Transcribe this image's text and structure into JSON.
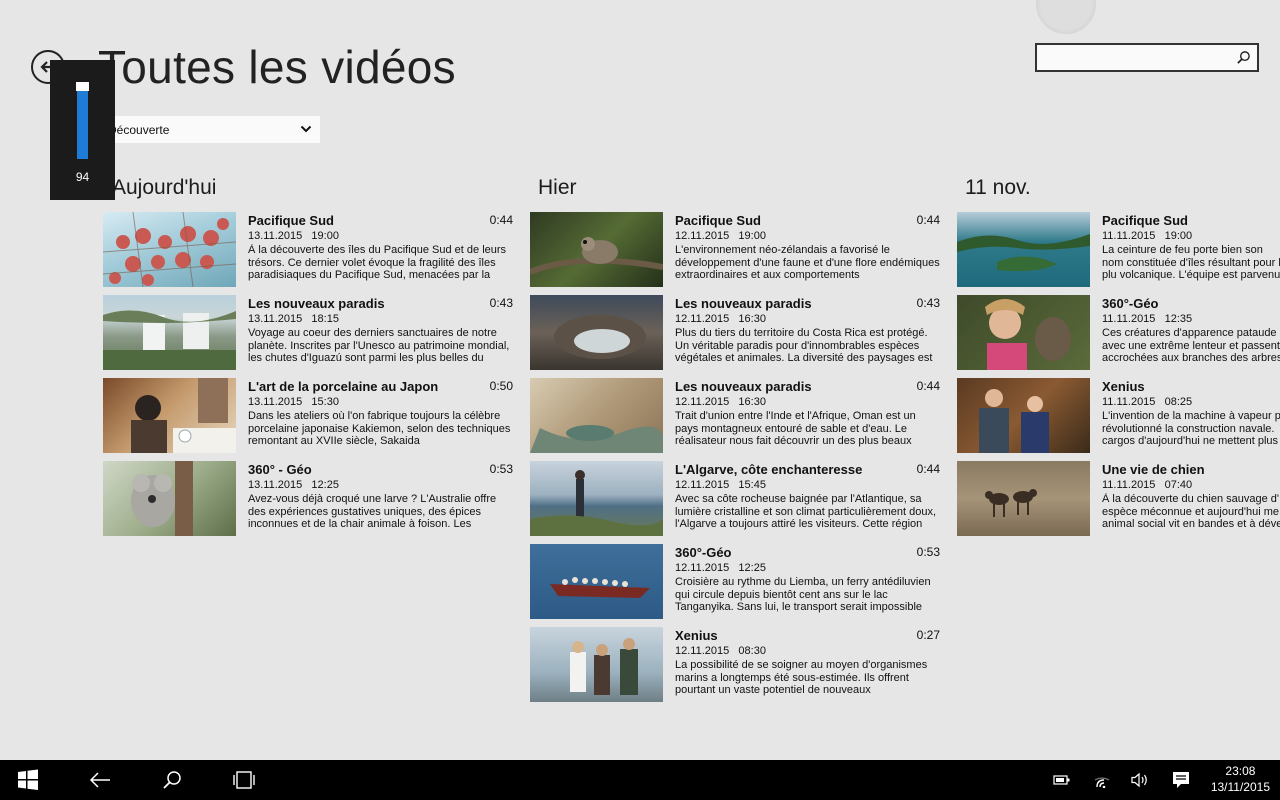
{
  "page": {
    "title": "Toutes les vidéos"
  },
  "filter": {
    "selected": "Découverte"
  },
  "search": {
    "value": "",
    "placeholder": ""
  },
  "volume": {
    "value": "94",
    "level_percent": 94
  },
  "groups": [
    {
      "title": "Aujourd'hui",
      "items": [
        {
          "title": "Pacifique Sud",
          "duration": "0:44",
          "date": "13.11.2015",
          "time": "19:00",
          "description": "À la découverte des îles du Pacifique Sud et de leurs trésors. Ce dernier volet évoque la fragilité des îles paradisiaques du Pacifique Sud, menacées par la"
        },
        {
          "title": "Les nouveaux paradis",
          "duration": "0:43",
          "date": "13.11.2015",
          "time": "18:15",
          "description": "Voyage au coeur des derniers sanctuaires de notre planète. Inscrites par l'Unesco au patrimoine mondial, les chutes d'Iguazú sont parmi les plus belles du"
        },
        {
          "title": "L'art de la porcelaine au Japon",
          "duration": "0:50",
          "date": "13.11.2015",
          "time": "15:30",
          "description": "Dans les ateliers où l'on fabrique toujours la célèbre porcelaine japonaise Kakiemon, selon des techniques remontant au XVIIe siècle, Sakaida"
        },
        {
          "title": "360° - Géo",
          "duration": "0:53",
          "date": "13.11.2015",
          "time": "12:25",
          "description": "Avez-vous déjà croqué une larve ? L'Australie offre des expériences gustatives uniques, des épices inconnues et de la chair animale à foison. Les"
        }
      ]
    },
    {
      "title": "Hier",
      "items": [
        {
          "title": "Pacifique Sud",
          "duration": "0:44",
          "date": "12.11.2015",
          "time": "19:00",
          "description": "L'environnement néo-zélandais a favorisé le développement d'une faune et d'une flore endémiques extraordinaires et aux comportements"
        },
        {
          "title": "Les nouveaux paradis",
          "duration": "0:43",
          "date": "12.11.2015",
          "time": "16:30",
          "description": "Plus du tiers du territoire du Costa Rica est protégé. Un véritable paradis pour d'innombrables espèces végétales et animales. La diversité des paysages est"
        },
        {
          "title": "Les nouveaux paradis",
          "duration": "0:44",
          "date": "12.11.2015",
          "time": "16:30",
          "description": "Trait d'union entre l'Inde et l'Afrique, Oman est un pays montagneux entouré de sable et d'eau. Le réalisateur nous fait découvrir un des plus beaux"
        },
        {
          "title": "L'Algarve, côte enchanteresse",
          "duration": "0:44",
          "date": "12.11.2015",
          "time": "15:45",
          "description": "Avec sa côte rocheuse baignée par l'Atlantique, sa lumière cristalline et son climat particulièrement doux, l'Algarve a toujours attiré les visiteurs. Cette région"
        },
        {
          "title": "360°-Géo",
          "duration": "0:53",
          "date": "12.11.2015",
          "time": "12:25",
          "description": "Croisière au rythme du Liemba, un ferry antédiluvien qui circule depuis bientôt cent ans sur le lac Tanganyika. Sans lui, le transport serait impossible"
        },
        {
          "title": "Xenius",
          "duration": "0:27",
          "date": "12.11.2015",
          "time": "08:30",
          "description": "La possibilité de se soigner au moyen d'organismes marins a longtemps été sous-estimée. Ils offrent pourtant un vaste potentiel de nouveaux"
        }
      ]
    },
    {
      "title": "11 nov.",
      "items": [
        {
          "title": "Pacifique Sud",
          "duration": "",
          "date": "11.11.2015",
          "time": "19:00",
          "description": "La ceinture de feu porte bien son nom constituée d'îles résultant pour la plu volcanique. L'équipe est parvenue p"
        },
        {
          "title": "360°-Géo",
          "duration": "",
          "date": "11.11.2015",
          "time": "12:35",
          "description": "Ces créatures d'apparence pataude avec une extrême lenteur et passent accrochées aux branches des arbres"
        },
        {
          "title": "Xenius",
          "duration": "",
          "date": "11.11.2015",
          "time": "08:25",
          "description": "L'invention de la machine à vapeur p révolutionné la construction navale. cargos d'aujourd'hui ne mettent plus"
        },
        {
          "title": "Une vie de chien",
          "duration": "",
          "date": "11.11.2015",
          "time": "07:40",
          "description": "À la découverte du chien sauvage d' espèce méconnue et aujourd'hui me animal social vit en bandes et à déve"
        }
      ]
    }
  ],
  "taskbar": {
    "time": "23:08",
    "date": "13/11/2015"
  },
  "colors": {
    "background": "#e6e6e6",
    "accent": "#1e7cd6",
    "taskbar": "#000000"
  }
}
